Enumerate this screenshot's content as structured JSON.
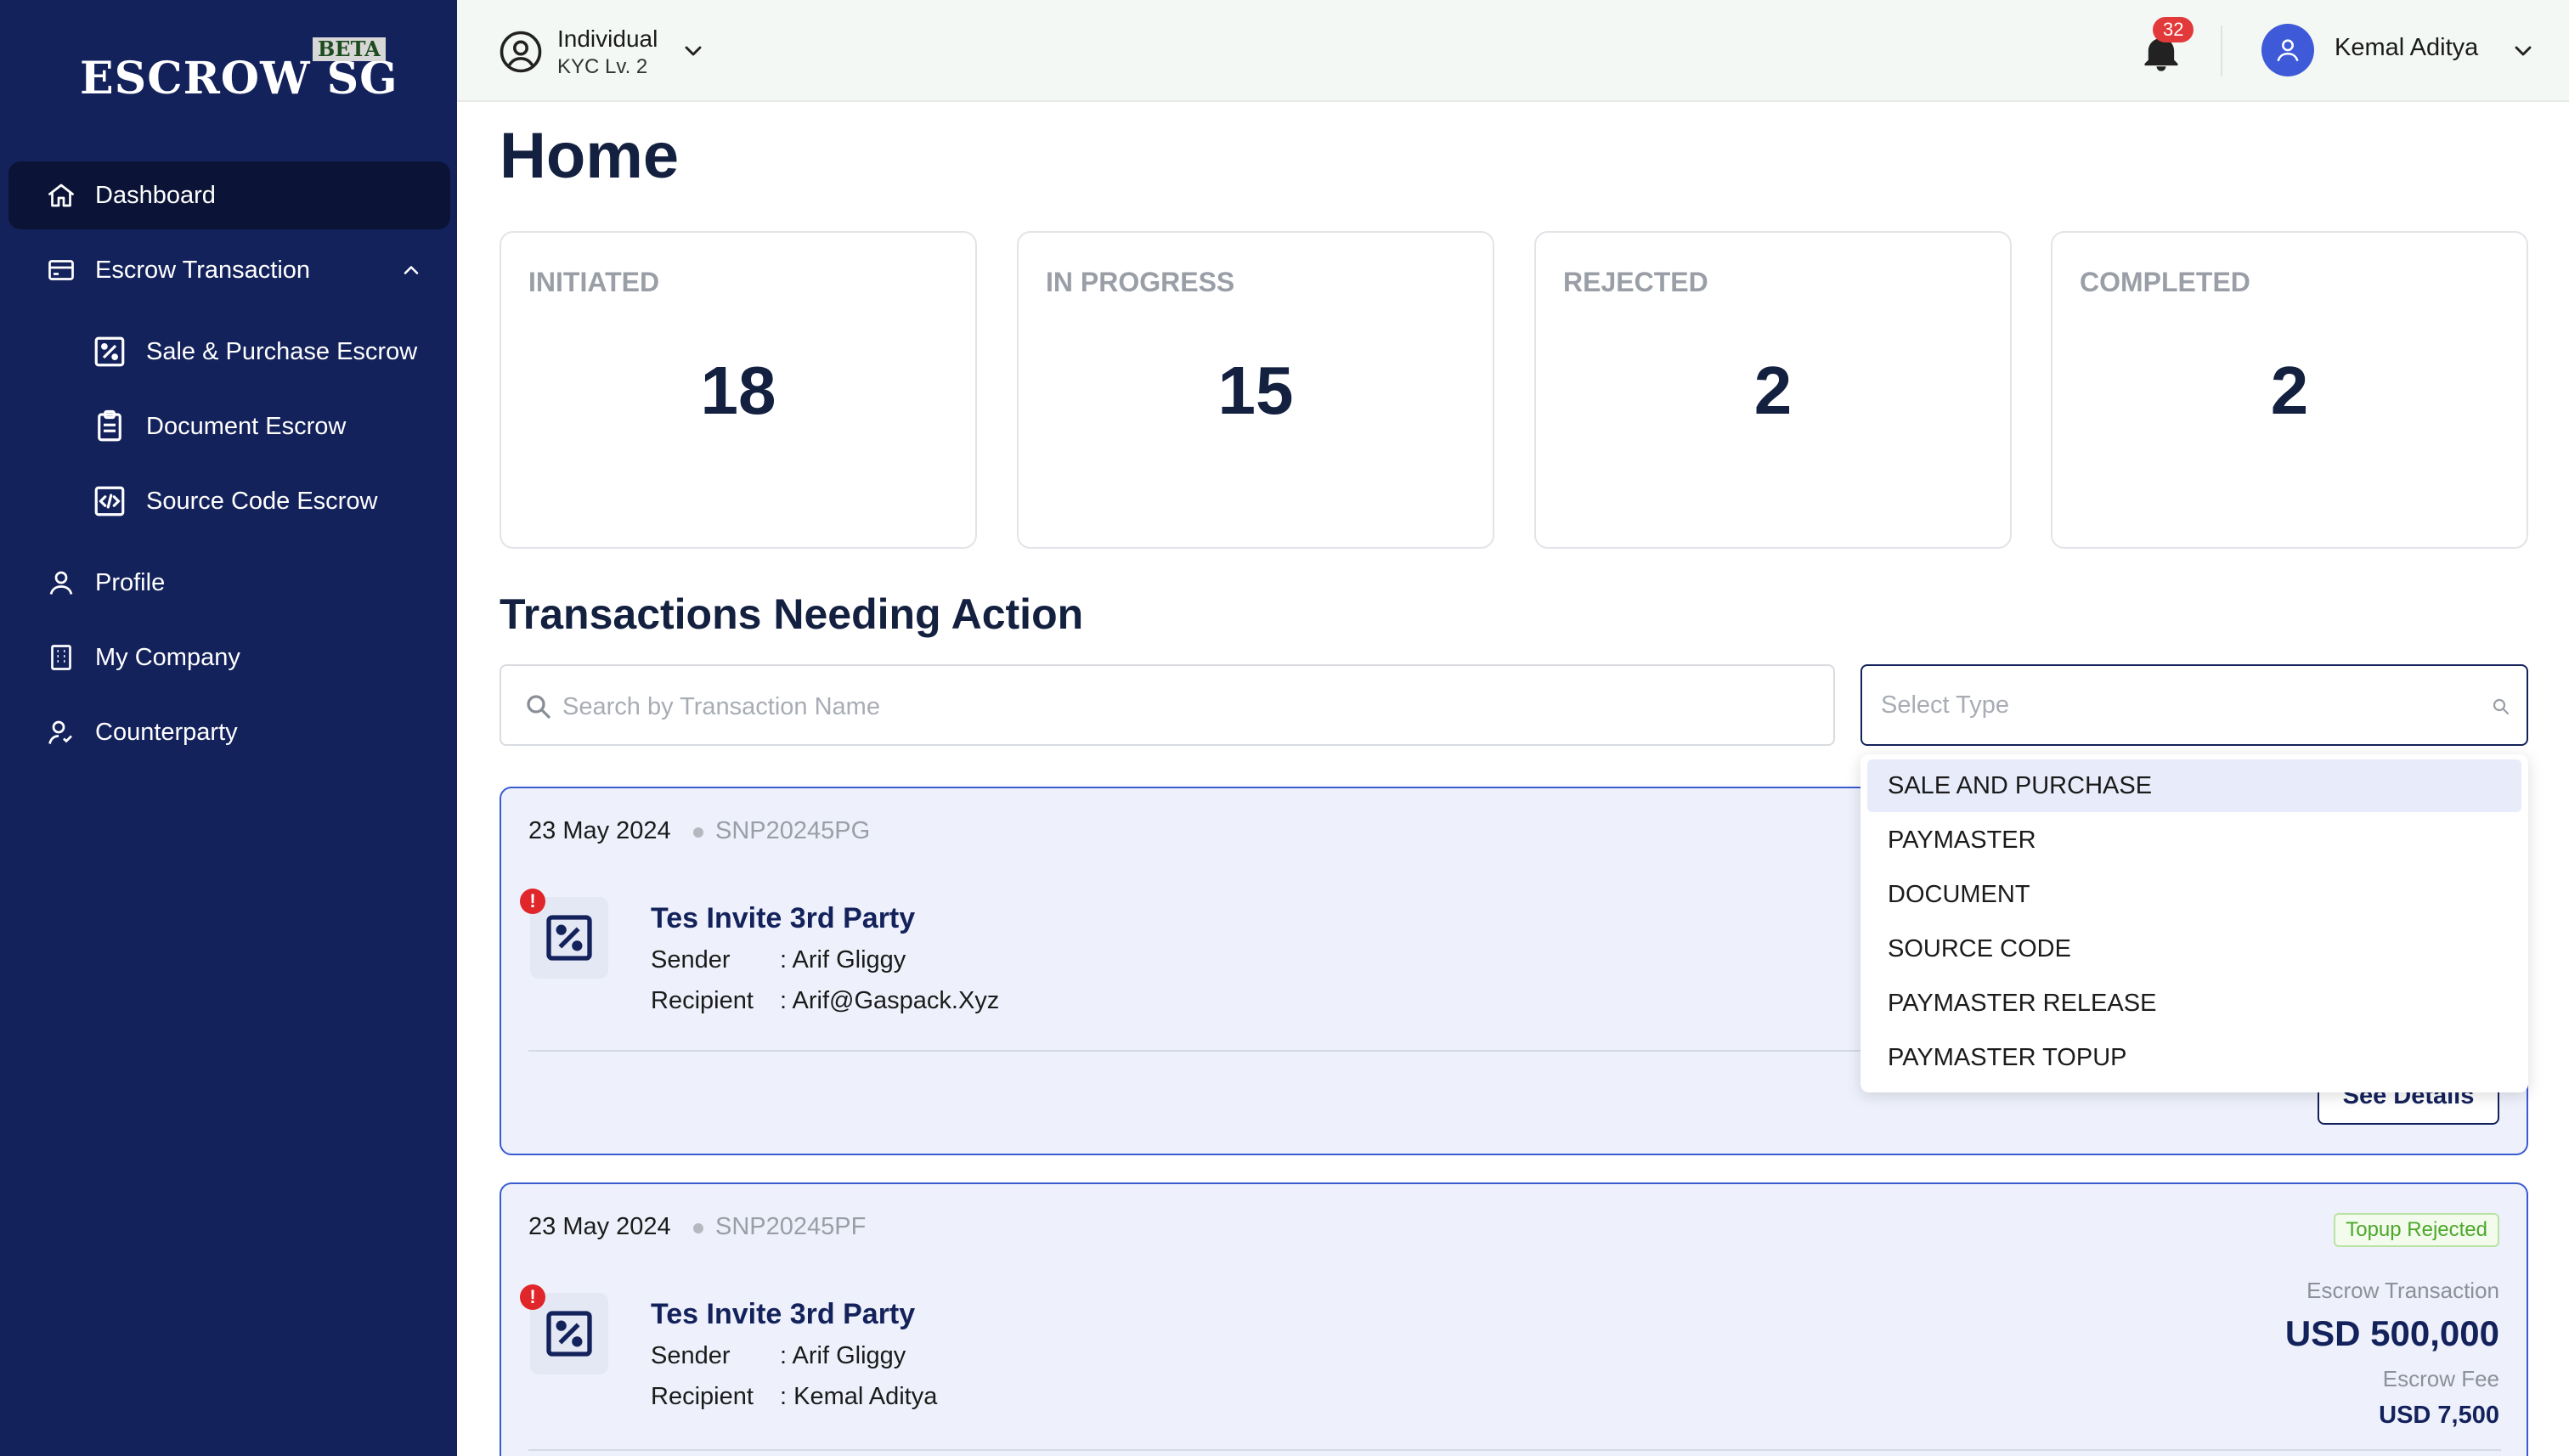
{
  "brand": {
    "logo": "ESCROW SG",
    "beta": "BETA"
  },
  "sidebar": {
    "items": [
      {
        "label": "Dashboard"
      },
      {
        "label": "Escrow Transaction"
      },
      {
        "label": "Sale & Purchase Escrow"
      },
      {
        "label": "Document Escrow"
      },
      {
        "label": "Source Code Escrow"
      },
      {
        "label": "Profile"
      },
      {
        "label": "My Company"
      },
      {
        "label": "Counterparty"
      }
    ]
  },
  "topbar": {
    "account_type": "Individual",
    "kyc": "KYC Lv. 2",
    "notifications": "32",
    "user_name": "Kemal Aditya"
  },
  "page": {
    "title": "Home"
  },
  "stats": [
    {
      "label": "INITIATED",
      "value": "18"
    },
    {
      "label": "IN PROGRESS",
      "value": "15"
    },
    {
      "label": "REJECTED",
      "value": "2"
    },
    {
      "label": "COMPLETED",
      "value": "2"
    }
  ],
  "section": {
    "title": "Transactions Needing Action"
  },
  "search": {
    "placeholder": "Search by Transaction Name"
  },
  "select": {
    "placeholder": "Select Type",
    "options": [
      "SALE AND PURCHASE",
      "PAYMASTER",
      "DOCUMENT",
      "SOURCE CODE",
      "PAYMASTER RELEASE",
      "PAYMASTER TOPUP"
    ]
  },
  "transactions": [
    {
      "date": "23 May 2024",
      "code": "SNP20245PG",
      "name": "Tes Invite 3rd Party",
      "sender_label": "Sender",
      "sender": ": Arif Gliggy",
      "recipient_label": "Recipient",
      "recipient": ": Arif@Gaspack.Xyz",
      "action": "See Details"
    },
    {
      "date": "23 May 2024",
      "code": "SNP20245PF",
      "name": "Tes Invite 3rd Party",
      "sender_label": "Sender",
      "sender": ": Arif Gliggy",
      "recipient_label": "Recipient",
      "recipient": ": Kemal Aditya",
      "status": "Topup Rejected",
      "amount_label": "Escrow Transaction",
      "amount": "USD 500,000",
      "fee_label": "Escrow Fee",
      "fee": "USD 7,500"
    }
  ],
  "icons": {
    "dashboard": "home-icon",
    "escrow": "card-icon",
    "sale": "percent-box-icon",
    "document": "clipboard-icon",
    "source": "code-box-icon",
    "profile": "user-icon",
    "company": "building-icon",
    "counterparty": "users-icon"
  },
  "colors": {
    "sidebar": "#14225c",
    "accent": "#3a5bd1",
    "badge": "#e23a3a",
    "avatar": "#3e5ad8"
  }
}
